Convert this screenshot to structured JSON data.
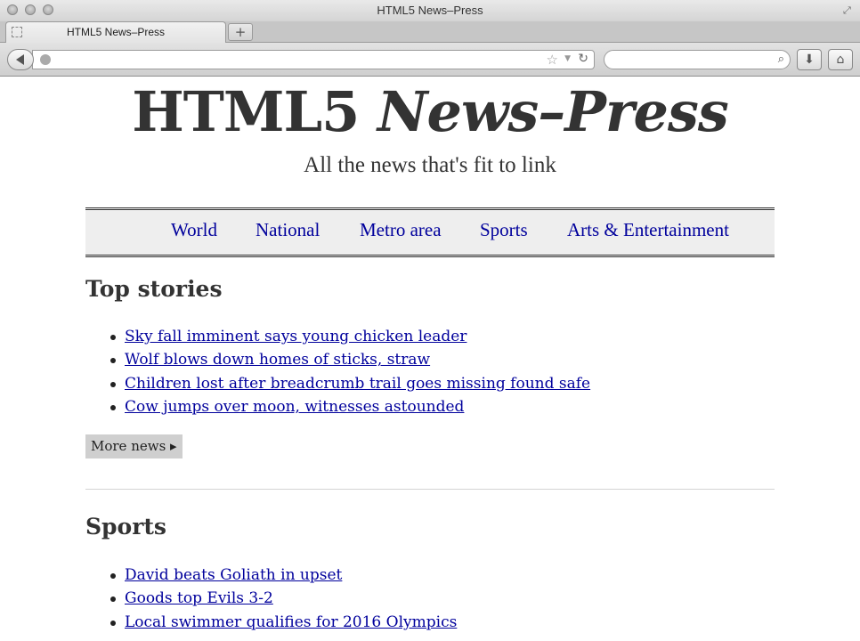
{
  "window": {
    "title": "HTML5 News–Press"
  },
  "tab": {
    "label": "HTML5 News–Press",
    "new_tab": "+"
  },
  "toolbar": {
    "url": "",
    "search": ""
  },
  "page": {
    "masthead": {
      "plain": "HTML5 ",
      "italic": "News–Press"
    },
    "tagline": "All the news that's fit to link",
    "nav": [
      "World",
      "National",
      "Metro area",
      "Sports",
      "Arts & Entertainment"
    ],
    "top_stories": {
      "heading": "Top stories",
      "items": [
        "Sky fall imminent says young chicken leader",
        "Wolf blows down homes of sticks, straw",
        "Children lost after breadcrumb trail goes missing found safe",
        "Cow jumps over moon, witnesses astounded"
      ],
      "more_label": "More news ▸"
    },
    "sports": {
      "heading": "Sports",
      "items": [
        "David beats Goliath in upset",
        "Goods top Evils 3-2",
        "Local swimmer qualifies for 2016 Olympics"
      ]
    }
  }
}
